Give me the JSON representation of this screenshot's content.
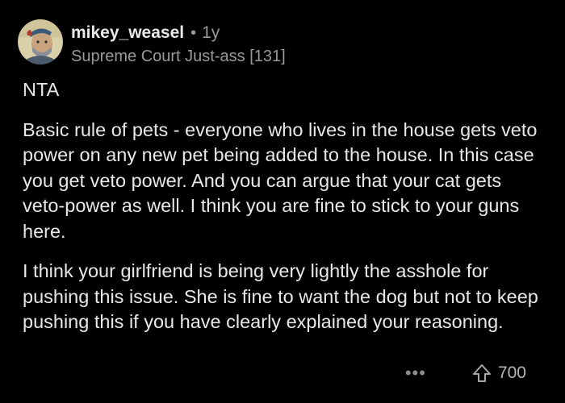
{
  "comment": {
    "username": "mikey_weasel",
    "separator": "•",
    "age": "1y",
    "flair": "Supreme Court Just-ass [131]",
    "paragraphs": [
      "NTA",
      "Basic rule of pets - everyone who lives in the house gets veto power on any new pet being added to the house.  In this case you get veto power.  And you can argue that your cat gets veto-power as well. I think you are fine to stick to your guns here.",
      "I think your girlfriend is being very lightly the asshole for pushing this issue.  She is fine to want the dog but not to keep pushing this if you have clearly explained your reasoning."
    ],
    "more_label": "•••",
    "score": "700"
  },
  "icons": {
    "avatar": "avatar-icon",
    "upvote": "upvote-arrow-icon"
  },
  "colors": {
    "background": "#000000",
    "text": "#e8e8e8",
    "muted": "#9a9a9a"
  }
}
